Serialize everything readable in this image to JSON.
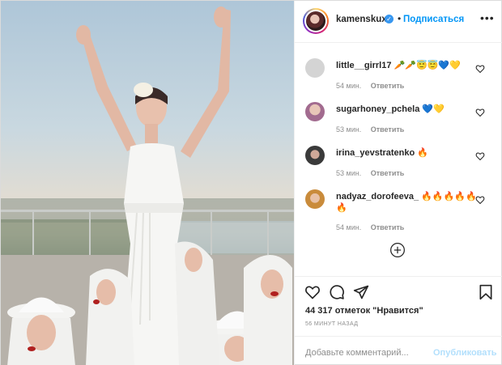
{
  "header": {
    "username": "kamenskux",
    "verified_mark": "✓",
    "separator": "•",
    "follow_label": "Подписаться",
    "more_label": "•••"
  },
  "comments": [
    {
      "user": "little__girrl17",
      "text": "🥕🥕😇😇💙💛",
      "time": "54 мин.",
      "reply": "Ответить",
      "avatar_color": "#cfcfcf"
    },
    {
      "user": "sugarhoney_pchela",
      "text": "💙💛",
      "time": "53 мин.",
      "reply": "Ответить",
      "avatar_color": "#b9a2c9"
    },
    {
      "user": "irina_yevstratenko",
      "text": "🔥",
      "time": "53 мин.",
      "reply": "Ответить",
      "avatar_color": "#555555"
    },
    {
      "user": "nadyaz_dorofeeva_",
      "text": "🔥🔥🔥🔥🔥🔥",
      "time": "54 мин.",
      "reply": "Ответить",
      "avatar_color": "#d9a35a"
    }
  ],
  "icons": {
    "like": "heart-icon",
    "comment": "comment-icon",
    "share": "share-icon",
    "save": "bookmark-icon",
    "load_more": "plus-circle-icon",
    "comment_like": "heart-icon"
  },
  "post": {
    "likes_text": "44 317 отметок \"Нравится\"",
    "time_ago": "56 МИНУТ НАЗАД",
    "comment_placeholder": "Добавьте комментарий...",
    "publish_label": "Опубликовать"
  },
  "colors": {
    "accent": "#0095f6",
    "publish_disabled": "#b2dffc",
    "verified": "#3897f0"
  }
}
